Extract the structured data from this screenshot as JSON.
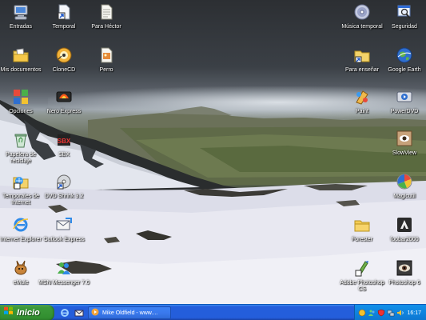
{
  "desktop": {
    "icons": [
      {
        "label": "Entradas",
        "icon": "computer-icon"
      },
      {
        "label": "Temporal",
        "icon": "shortcut-document-icon"
      },
      {
        "label": "Para Héctor",
        "icon": "text-document-icon"
      },
      {
        "label": "Música temporal",
        "icon": "music-cd-icon"
      },
      {
        "label": "Seguridad",
        "icon": "search-window-icon"
      },
      {
        "label": "Mis documentos",
        "icon": "my-documents-icon"
      },
      {
        "label": "CloneCD",
        "icon": "clonecd-icon"
      },
      {
        "label": "Perro",
        "icon": "image-file-icon"
      },
      {
        "label": "Para enseñar",
        "icon": "folder-shortcut-icon"
      },
      {
        "label": "Google Earth",
        "icon": "google-earth-icon"
      },
      {
        "label": "Opciones",
        "icon": "control-panel-icon"
      },
      {
        "label": "Nero Express",
        "icon": "nero-express-icon"
      },
      {
        "label": "Paint",
        "icon": "paint-icon"
      },
      {
        "label": "PowerDVD",
        "icon": "powerdvd-icon"
      },
      {
        "label": "Papelera de reciclaje",
        "icon": "recycle-bin-icon"
      },
      {
        "label": "SBX",
        "icon": "sbx-icon"
      },
      {
        "label": "SlowView",
        "icon": "slowview-icon"
      },
      {
        "label": "Temporales de Internet",
        "icon": "internet-temp-icon"
      },
      {
        "label": "DVD Shrink 3.2",
        "icon": "dvd-shrink-icon"
      },
      {
        "label": "Magicutil",
        "icon": "magicutil-icon"
      },
      {
        "label": "Internet Explorer",
        "icon": "internet-explorer-icon"
      },
      {
        "label": "Outlook Express",
        "icon": "outlook-express-icon"
      },
      {
        "label": "Forester",
        "icon": "folder-icon"
      },
      {
        "label": "foobar2000",
        "icon": "foobar2000-icon"
      },
      {
        "label": "eMule",
        "icon": "emule-icon"
      },
      {
        "label": "MSN Messenger 7.0",
        "icon": "msn-messenger-icon"
      },
      {
        "label": "Adobe Photoshop CS",
        "icon": "photoshop-cs-icon"
      },
      {
        "label": "Photoshop 6",
        "icon": "photoshop-6-icon"
      }
    ]
  },
  "taskbar": {
    "start_label": "Inicio",
    "quick_launch": [
      "internet-explorer-icon",
      "outlook-express-icon"
    ],
    "task_label": "Mike Oldfield - www....",
    "tray_icons": [
      "emule-tray-icon",
      "msn-tray-icon",
      "shield-tray-icon",
      "network-tray-icon",
      "volume-tray-icon"
    ],
    "clock": "16:17"
  },
  "colors": {
    "taskbar_blue": "#245edb",
    "start_green": "#3c9a3a",
    "tray_blue": "#0f83df"
  }
}
